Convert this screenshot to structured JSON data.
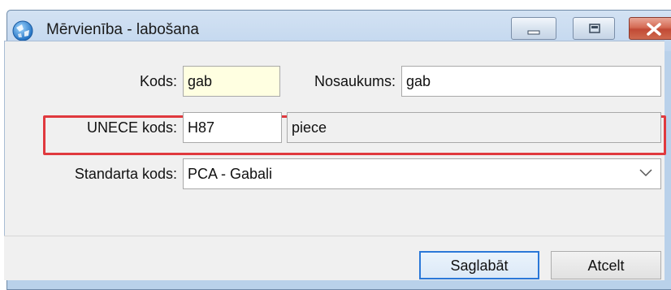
{
  "window": {
    "title": "Mērvienība - labošana",
    "icon": "app-globe-icon"
  },
  "form": {
    "kods_label": "Kods:",
    "kods_value": "gab",
    "nosaukums_label": "Nosaukums:",
    "nosaukums_value": "gab",
    "unece_label": "UNECE kods:",
    "unece_code": "H87",
    "unece_name": "piece",
    "standarta_label": "Standarta kods:",
    "standarta_value": "PCA - Gabali"
  },
  "buttons": {
    "save_label": "Saglabāt",
    "cancel_label": "Atcelt"
  },
  "colors": {
    "highlight": "#e0393e",
    "required_field": "#ffffe1",
    "default_button_border": "#2b78d8"
  }
}
